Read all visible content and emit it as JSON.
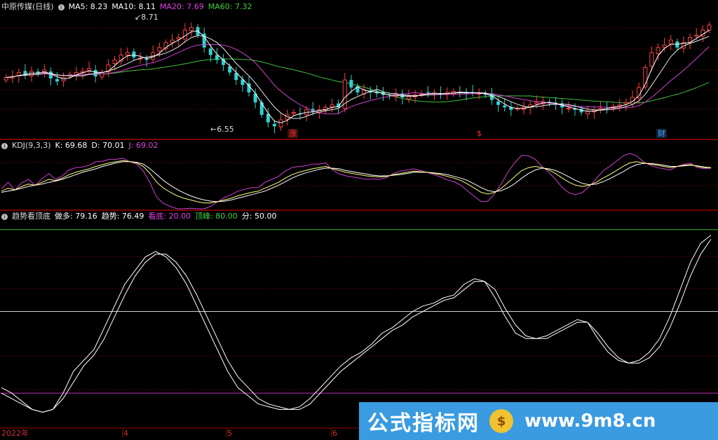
{
  "stock": {
    "name": "中原传媒(日线)",
    "settings_icon": "circle-info-icon"
  },
  "ma_legend": [
    {
      "label": "MA5: 8.23",
      "color": "#ffffff"
    },
    {
      "label": "MA10: 8.11",
      "color": "#ffffff"
    },
    {
      "label": "MA20: 7.69",
      "color": "#e040e0"
    },
    {
      "label": "MA60: 7.32",
      "color": "#40d040"
    }
  ],
  "price_annotations": {
    "high": "8.71",
    "low": "6.55"
  },
  "event_badges": [
    {
      "text": "涨",
      "color": "#ff3030"
    },
    {
      "text": "$",
      "color": "#ff3030"
    },
    {
      "text": "财",
      "color": "#4aa3ff"
    }
  ],
  "kdj_legend": {
    "title": "KDJ(9,3,3)",
    "items": [
      {
        "label": "K: 69.68",
        "color": "#ffffff"
      },
      {
        "label": "D: 70.01",
        "color": "#ffffff"
      },
      {
        "label": "J: 69.02",
        "color": "#e040e0"
      }
    ]
  },
  "trend_legend": {
    "title": "趋势看顶底",
    "items": [
      {
        "label": "做多: 79.16",
        "color": "#ffffff"
      },
      {
        "label": "趋势: 76.49",
        "color": "#ffffff"
      },
      {
        "label": "看底: 20.00",
        "color": "#e040e0"
      },
      {
        "label": "顶峰: 80.00",
        "color": "#40d040"
      },
      {
        "label": "分: 50.00",
        "color": "#ffffff"
      }
    ]
  },
  "x_axis": {
    "ticks": [
      "2022年",
      "4",
      "5",
      "6"
    ]
  },
  "watermark": {
    "title": "公式指标网",
    "logo": "$",
    "url": "www.9m8.cn"
  },
  "chart_data": [
    {
      "type": "candlestick",
      "title": "中原传媒(日线)",
      "high_label": 8.71,
      "low_label": 6.55,
      "close": [
        7.6,
        7.62,
        7.7,
        7.65,
        7.72,
        7.68,
        7.75,
        7.58,
        7.52,
        7.6,
        7.66,
        7.7,
        7.72,
        7.78,
        7.62,
        7.7,
        7.85,
        7.95,
        8.05,
        8.1,
        8.0,
        7.98,
        7.95,
        8.1,
        8.2,
        8.3,
        8.35,
        8.4,
        8.55,
        8.6,
        8.45,
        8.2,
        8.05,
        7.95,
        7.85,
        7.7,
        7.55,
        7.45,
        7.3,
        7.1,
        6.85,
        6.7,
        6.62,
        6.75,
        6.85,
        6.9,
        6.86,
        6.95,
        6.92,
        6.95,
        7.0,
        7.05,
        7.0,
        7.55,
        7.4,
        7.3,
        7.35,
        7.3,
        7.28,
        7.25,
        7.22,
        7.26,
        7.2,
        7.22,
        7.25,
        7.28,
        7.3,
        7.28,
        7.25,
        7.3,
        7.32,
        7.3,
        7.28,
        7.3,
        7.28,
        7.25,
        7.15,
        7.05,
        7.0,
        6.95,
        6.98,
        7.0,
        7.05,
        7.1,
        7.12,
        7.08,
        7.05,
        7.0,
        6.98,
        6.95,
        6.9,
        6.92,
        6.95,
        6.98,
        7.0,
        7.02,
        7.05,
        7.1,
        7.2,
        7.4,
        7.8,
        8.1,
        8.2,
        8.25,
        8.35,
        8.2,
        8.3,
        8.4,
        8.45,
        8.55,
        8.65
      ],
      "ma_values_last": {
        "MA5": 8.23,
        "MA10": 8.11,
        "MA20": 7.69,
        "MA60": 7.32
      }
    },
    {
      "type": "line",
      "title": "KDJ(9,3,3)",
      "last": {
        "K": 69.68,
        "D": 70.01,
        "J": 69.02
      },
      "k": [
        30,
        35,
        32,
        38,
        42,
        40,
        45,
        50,
        48,
        52,
        58,
        62,
        65,
        68,
        72,
        75,
        78,
        80,
        82,
        80,
        78,
        72,
        60,
        45,
        35,
        28,
        22,
        18,
        15,
        12,
        10,
        10,
        12,
        15,
        18,
        22,
        25,
        28,
        30,
        35,
        40,
        45,
        52,
        58,
        62,
        65,
        68,
        70,
        72,
        68,
        65,
        62,
        60,
        58,
        56,
        55,
        54,
        55,
        58,
        60,
        62,
        64,
        63,
        62,
        60,
        58,
        55,
        52,
        48,
        42,
        35,
        28,
        25,
        28,
        35,
        45,
        55,
        65,
        70,
        72,
        70,
        66,
        60,
        52,
        45,
        40,
        38,
        40,
        45,
        52,
        58,
        65,
        72,
        78,
        80,
        78,
        76,
        74,
        72,
        70,
        72,
        74,
        75,
        72,
        70,
        69.68
      ],
      "d": [
        28,
        30,
        32,
        35,
        38,
        40,
        42,
        45,
        47,
        50,
        54,
        58,
        62,
        65,
        68,
        72,
        75,
        78,
        80,
        80,
        79,
        76,
        68,
        58,
        48,
        40,
        33,
        27,
        22,
        18,
        15,
        13,
        12,
        13,
        15,
        18,
        21,
        24,
        27,
        30,
        35,
        40,
        46,
        52,
        57,
        61,
        64,
        67,
        69,
        69,
        68,
        65,
        63,
        61,
        59,
        57,
        56,
        56,
        57,
        58,
        60,
        62,
        62,
        62,
        61,
        60,
        58,
        55,
        52,
        48,
        42,
        36,
        31,
        29,
        31,
        36,
        43,
        52,
        60,
        66,
        69,
        68,
        65,
        60,
        54,
        48,
        43,
        41,
        42,
        46,
        51,
        57,
        63,
        70,
        75,
        77,
        77,
        76,
        74,
        72,
        72,
        73,
        74,
        73,
        71,
        70.01
      ],
      "j": [
        34,
        45,
        32,
        44,
        50,
        40,
        51,
        60,
        50,
        56,
        66,
        70,
        71,
        74,
        80,
        81,
        84,
        84,
        86,
        80,
        76,
        64,
        44,
        19,
        9,
        4,
        0,
        0,
        1,
        0,
        0,
        4,
        12,
        19,
        24,
        30,
        33,
        36,
        36,
        45,
        50,
        55,
        64,
        70,
        72,
        73,
        76,
        76,
        78,
        66,
        59,
        56,
        54,
        52,
        50,
        51,
        50,
        53,
        60,
        64,
        66,
        68,
        65,
        62,
        58,
        54,
        49,
        46,
        40,
        30,
        21,
        12,
        13,
        26,
        43,
        63,
        79,
        91,
        90,
        84,
        72,
        62,
        50,
        36,
        27,
        24,
        28,
        38,
        51,
        64,
        72,
        81,
        90,
        94,
        90,
        80,
        74,
        70,
        68,
        66,
        72,
        76,
        77,
        70,
        68,
        69.02
      ]
    },
    {
      "type": "line",
      "title": "趋势看顶底",
      "last": {
        "做多": 79.16,
        "趋势": 76.49
      },
      "levels": {
        "看底": 20.0,
        "顶峰": 80.0,
        "分": 50.0
      },
      "ylim": [
        10,
        82
      ],
      "zuoduo": [
        22,
        20,
        17,
        14,
        13,
        14,
        20,
        28,
        32,
        36,
        44,
        52,
        60,
        65,
        70,
        72,
        70,
        66,
        60,
        52,
        44,
        36,
        28,
        22,
        19,
        16,
        15,
        14,
        14,
        15,
        18,
        22,
        26,
        30,
        33,
        35,
        38,
        42,
        44,
        47,
        50,
        52,
        53,
        55,
        56,
        60,
        62,
        61,
        55,
        48,
        42,
        40,
        40,
        41,
        43,
        45,
        47,
        46,
        40,
        35,
        32,
        31,
        32,
        35,
        40,
        48,
        58,
        68,
        75,
        78
      ],
      "qushi": [
        20,
        18,
        16,
        14,
        13,
        14,
        18,
        24,
        30,
        34,
        40,
        48,
        56,
        63,
        68,
        71,
        71,
        68,
        63,
        56,
        48,
        40,
        32,
        26,
        22,
        18,
        16,
        15,
        14,
        14,
        16,
        20,
        24,
        28,
        31,
        34,
        37,
        40,
        43,
        45,
        48,
        50,
        52,
        54,
        55,
        58,
        61,
        61,
        58,
        51,
        45,
        41,
        40,
        40,
        42,
        44,
        46,
        46,
        42,
        37,
        33,
        31,
        31,
        33,
        37,
        44,
        53,
        63,
        71,
        76.49
      ]
    }
  ]
}
